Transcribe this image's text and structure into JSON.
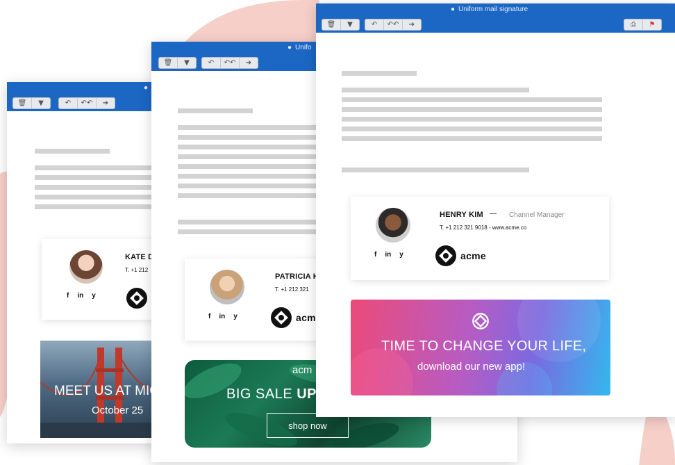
{
  "windows": [
    {
      "id": "back",
      "title": "",
      "toolbar": {
        "group1": [
          "trash-icon",
          "thumbs-down-icon"
        ],
        "group2": [
          "reply-icon",
          "reply-all-icon",
          "forward-icon"
        ]
      },
      "signature": {
        "name": "KATE D",
        "phone": "T. +1 212",
        "social": [
          "f",
          "in",
          "y"
        ]
      },
      "banner": {
        "headline": "MEET US AT MIC",
        "subline": "October 25"
      }
    },
    {
      "id": "middle",
      "title": "Unifo",
      "toolbar": {
        "group1": [
          "trash-icon",
          "thumbs-down-icon"
        ],
        "group2": [
          "reply-icon",
          "reply-all-icon",
          "forward-icon"
        ]
      },
      "signature": {
        "name": "PATRICIA H",
        "phone": "T. +1 212 321",
        "social": [
          "f",
          "in",
          "y"
        ],
        "logo_text": "acm"
      },
      "banner": {
        "brand": "acm",
        "headline_light": "BIG SALE ",
        "headline_bold": "UP",
        "button": "shop now"
      }
    },
    {
      "id": "front",
      "title": "Uniform mail signature",
      "toolbar": {
        "group1": [
          "trash-icon",
          "thumbs-down-icon"
        ],
        "group2": [
          "reply-icon",
          "reply-all-icon",
          "forward-icon"
        ],
        "right": [
          "print-icon",
          "flag-icon"
        ]
      },
      "signature": {
        "name": "HENRY KIM",
        "separator": "—",
        "role": "Channel Manager",
        "phone": "T. +1 212 321 9018 - www.acme.co",
        "social": [
          "f",
          "in",
          "y"
        ],
        "logo_text": "acme"
      },
      "banner": {
        "headline": "TIME TO CHANGE YOUR LIFE,",
        "subline": "download our new app!"
      }
    }
  ],
  "colors": {
    "titlebar": "#1c66c4",
    "accent_shape": "#f6c7c1",
    "banner_gradient": [
      "#ec4a78",
      "#8a5fd6",
      "#33b8ee"
    ]
  }
}
